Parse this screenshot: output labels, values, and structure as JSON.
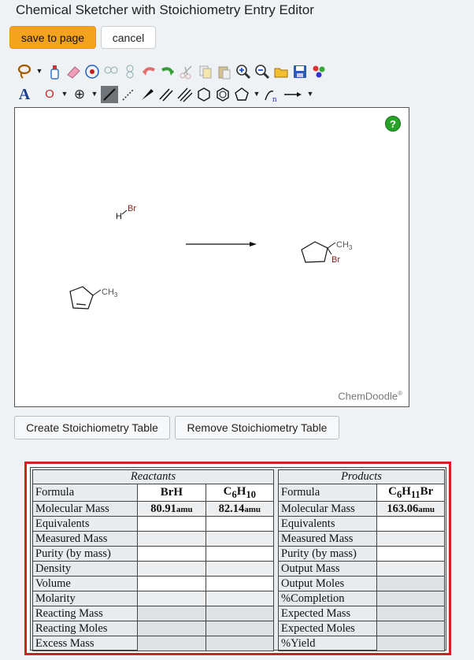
{
  "app": {
    "title": "Chemical Sketcher with Stoichiometry Entry Editor"
  },
  "actions": {
    "save_label": "save to page",
    "cancel_label": "cancel"
  },
  "toolbar_row1": [
    "lasso-icon",
    "dropdown-arrow-icon",
    "cleaner-bottle-icon",
    "eraser-icon",
    "center-icon",
    "flip-horizontal-icon",
    "flip-vertical-icon",
    "undo-icon",
    "redo-icon",
    "scissors-icon",
    "copy-icon",
    "paste-icon",
    "zoom-in-icon",
    "zoom-out-icon",
    "open-folder-icon",
    "save-disk-icon",
    "templates-icon"
  ],
  "toolbar_row2": {
    "text_tool": "A",
    "element": "O",
    "charge": "⊕",
    "tools": [
      "single-bond-icon",
      "dashed-bond-icon",
      "wedge-bond-icon",
      "double-bond-icon",
      "triple-bond-icon",
      "benzene-icon",
      "cyclohexane-icon",
      "pentagon-icon",
      "chain-icon",
      "arrow-icon"
    ]
  },
  "canvas": {
    "help_label": "?",
    "watermark": "ChemDoodle",
    "reactant1": {
      "h": "H",
      "br": "Br"
    },
    "reactant2": {
      "methyl": "CH",
      "sub": "3"
    },
    "product": {
      "methyl": "CH",
      "sub": "3",
      "br": "Br"
    }
  },
  "stoich_buttons": {
    "create": "Create Stoichiometry Table",
    "remove": "Remove Stoichiometry Table"
  },
  "reactants": {
    "header": "Reactants",
    "formula_label": "Formula",
    "compounds": [
      {
        "main": "BrH",
        "mass": "80.91",
        "unit": "amu"
      },
      {
        "c": "C",
        "c_n": "6",
        "h": "H",
        "h_n": "10",
        "mass": "82.14",
        "unit": "amu"
      }
    ],
    "rows": [
      "Molecular Mass",
      "Equivalents",
      "Measured Mass",
      "Purity (by mass)",
      "Density",
      "Volume",
      "Molarity",
      "Reacting Mass",
      "Reacting Moles",
      "Excess Mass"
    ]
  },
  "products": {
    "header": "Products",
    "formula_label": "Formula",
    "compound": {
      "c": "C",
      "c_n": "6",
      "h": "H",
      "h_n": "11",
      "br": "Br",
      "mass": "163.06",
      "unit": "amu"
    },
    "rows": [
      "Molecular Mass",
      "Equivalents",
      "Measured Mass",
      "Purity (by mass)",
      "Output Mass",
      "Output Moles",
      "%Completion",
      "Expected Mass",
      "Expected Moles",
      "%Yield"
    ]
  }
}
